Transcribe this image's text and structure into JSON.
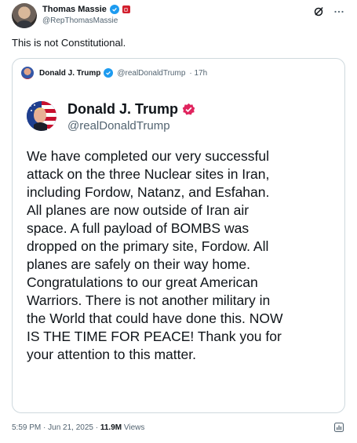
{
  "author": {
    "name": "Thomas Massie",
    "handle": "@RepThomasMassie"
  },
  "tweet": {
    "text": "This is not Constitutional."
  },
  "quoted": {
    "header_name": "Donald J. Trump",
    "header_handle": "@realDonaldTrump",
    "time_ago": "· 17h",
    "post_name": "Donald J. Trump",
    "post_handle": "@realDonaldTrump",
    "body_lines": [
      "We have completed our very successful",
      "attack on the three Nuclear sites in Iran,",
      "including Fordow, Natanz, and Esfahan.",
      "All planes are now outside of Iran air",
      "space. A full payload of BOMBS was",
      "dropped on the primary site, Fordow. All",
      "planes are safely on their way home.",
      "Congratulations to our great American",
      "Warriors. There is not another military in",
      "the World that could have done this. NOW",
      "IS THE TIME FOR PEACE! Thank you for",
      "your attention to this matter."
    ]
  },
  "footer": {
    "timestamp": "5:59 PM · Jun 21, 2025 · ",
    "views_count": "11.9M",
    "views_label": " Views"
  },
  "icons": [
    "verified-badge-icon",
    "flag-badge-icon",
    "grok-icon",
    "more-icon",
    "pink-verified-icon",
    "view-stats-icon"
  ],
  "colors": {
    "verified_blue": "#1d9bf0",
    "secondary_text": "#536471",
    "border": "#cfd9de",
    "pink_badge": "#e0245e"
  }
}
